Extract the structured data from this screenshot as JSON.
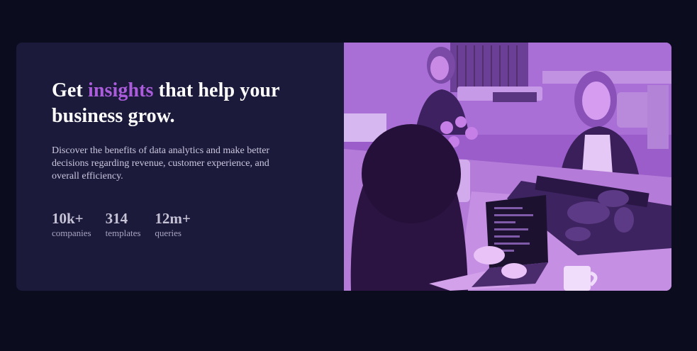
{
  "hero": {
    "headline_before": "Get ",
    "headline_accent": "insights",
    "headline_after": " that help your business grow.",
    "description": "Discover the benefits of data analytics and make better decisions regarding revenue, customer experience, and overall efficiency.",
    "stats": [
      {
        "value": "10k+",
        "label": "companies"
      },
      {
        "value": "314",
        "label": "templates"
      },
      {
        "value": "12m+",
        "label": "queries"
      }
    ]
  },
  "colors": {
    "page_background": "#0b0d1e",
    "card_background": "#1b1a3b",
    "accent": "#ab5cdb",
    "photo_overlay": "#9658c6"
  }
}
